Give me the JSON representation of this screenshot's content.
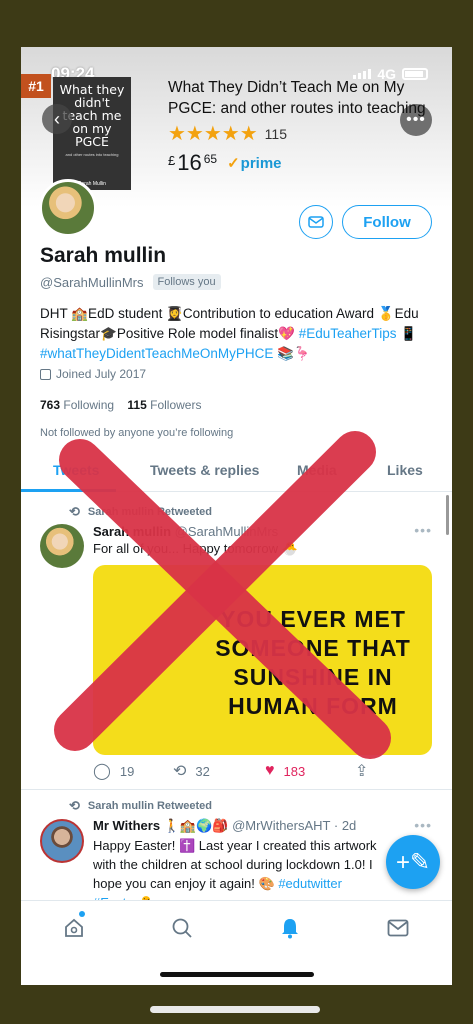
{
  "status_bar": {
    "time": "09:24",
    "network": "4G"
  },
  "product": {
    "rank": "#1",
    "title": "What They Didn’t Teach Me on My PGCE: and other routes into teaching",
    "stars": "★★★★★",
    "rating_count": "115",
    "currency": "£",
    "price_main": "16",
    "price_fraction": "65",
    "prime_label": "prime",
    "prime_check": "✓",
    "book_cover_title": "What they didn't teach me on my PGCE",
    "book_cover_subtitle": "and other routes into teaching",
    "book_cover_author": "Sarah Mullin"
  },
  "profile": {
    "name": "Sarah mullin",
    "handle": "@SarahMullinMrs",
    "follows_you": "Follows you",
    "follow_label": "Follow",
    "bio_text": "DHT 🏫EdD student 👩‍🎓Contribution to education Award 🥇Edu Risingstar🎓Positive Role model finalist💖",
    "bio_link1": "#EduTeaherTips",
    "bio_mid": "📱",
    "bio_link2": "#whatTheyDidentTeachMeOnMyPHCE",
    "bio_end": "📚🦩",
    "joined": "Joined July 2017",
    "following_count": "763",
    "following_label": "Following",
    "followers_count": "115",
    "followers_label": "Followers",
    "not_followed": "Not followed by anyone you’re following"
  },
  "tabs": [
    {
      "label": "Tweets"
    },
    {
      "label": "Tweets & replies"
    },
    {
      "label": "Media"
    },
    {
      "label": "Likes"
    }
  ],
  "tweets": [
    {
      "retweet_label": "Sarah mullin Retweeted",
      "author": "Sarah mullin",
      "handle": "@SarahMullinMrs",
      "text": "For all of you... Happy tomorrow 🐣",
      "image_text": "YOU EVER MET SOMEONE THAT SUNSHINE IN HUMAN FORM",
      "replies": "19",
      "retweets": "32",
      "likes": "183"
    },
    {
      "retweet_label": "Sarah mullin Retweeted",
      "author": "Mr Withers",
      "author_emoji": "🚶🏫🌍🎒",
      "handle": "@MrWithersAHT",
      "time": "· 2d",
      "text": "Happy Easter! ✝️ Last year I created this artwork with the children at school during lockdown 1.0! I hope you can enjoy it again! 🎨",
      "hashtags": "#edutwitter #Easter🐣"
    }
  ],
  "icons": {
    "back": "‹",
    "more": "•••",
    "retweet": "⟲",
    "reply": "◯",
    "like": "♥",
    "share": "⇪",
    "compose": "+✎"
  },
  "colors": {
    "accent": "#1da1f2",
    "like": "#e0245e",
    "cross": "#d93347",
    "stars": "#f3a20f"
  }
}
